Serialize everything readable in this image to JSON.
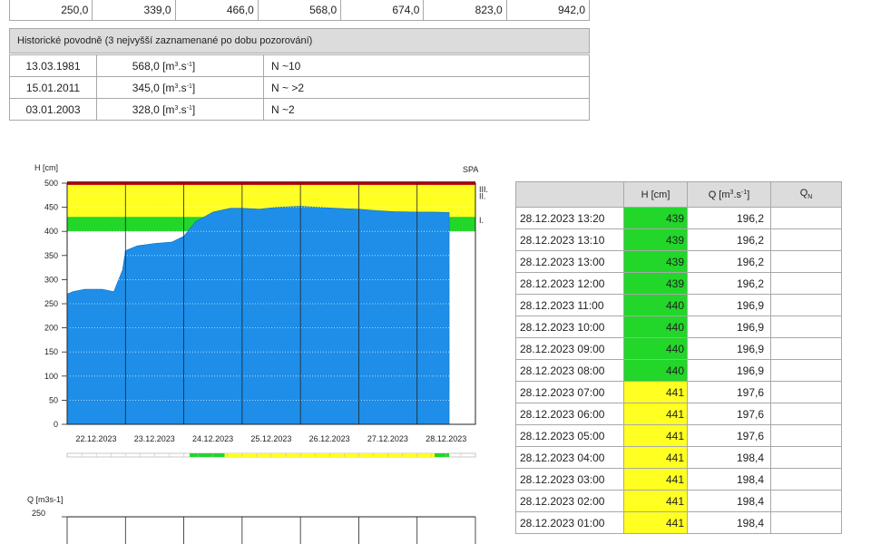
{
  "top_values": [
    "250,0",
    "339,0",
    "466,0",
    "568,0",
    "674,0",
    "823,0",
    "942,0"
  ],
  "historical": {
    "heading": "Historické povodně (3 nejvyšší zaznamenané po dobu pozorování)",
    "rows": [
      {
        "date": "13.03.1981",
        "q": "568,0 [m",
        "q_unit_sup": "3",
        "q_unit_rest": ".s",
        "q_unit_sup2": "-1",
        "q_close": "]",
        "n": "N ~10"
      },
      {
        "date": "15.01.2011",
        "q": "345,0 [m",
        "q_unit_sup": "3",
        "q_unit_rest": ".s",
        "q_unit_sup2": "-1",
        "q_close": "]",
        "n": "N ~ >2"
      },
      {
        "date": "03.01.2003",
        "q": "328,0 [m",
        "q_unit_sup": "3",
        "q_unit_rest": ".s",
        "q_unit_sup2": "-1",
        "q_close": "]",
        "n": "N ~2"
      }
    ]
  },
  "chart_data": {
    "type": "area",
    "ylabel": "H [cm]",
    "spa_label": "SPA",
    "levels": [
      {
        "name": "III.",
        "from": 480,
        "to": 500,
        "color": "#ffff22"
      },
      {
        "name": "II.",
        "from": 430,
        "to": 480,
        "color": "#ffff22"
      },
      {
        "name": "I.",
        "from": 400,
        "to": 430,
        "color": "#22d62a"
      }
    ],
    "extreme_line": {
      "value": 500,
      "color": "#d01010"
    },
    "ylim": [
      0,
      500
    ],
    "yticks": [
      0,
      50,
      100,
      150,
      200,
      250,
      300,
      350,
      400,
      450,
      500
    ],
    "categories": [
      "22.12.2023",
      "23.12.2023",
      "24.12.2023",
      "25.12.2023",
      "26.12.2023",
      "27.12.2023",
      "28.12.2023"
    ],
    "x": [
      0,
      0.1,
      0.3,
      0.6,
      0.8,
      0.95,
      1.0,
      1.2,
      1.5,
      1.8,
      2.0,
      2.2,
      2.5,
      2.8,
      3.0,
      3.3,
      3.6,
      4.0,
      4.3,
      4.6,
      5.0,
      5.3,
      5.6,
      6.0,
      6.3,
      6.55
    ],
    "values": [
      270,
      275,
      280,
      280,
      275,
      320,
      360,
      370,
      375,
      378,
      390,
      420,
      440,
      448,
      448,
      446,
      450,
      452,
      450,
      448,
      446,
      443,
      441,
      440,
      440,
      439
    ],
    "series_color": "#1e8ee8",
    "q_chart": {
      "ylabel": "Q [m3s-1]",
      "ylabel_sup": "3",
      "ylabel_sup2": "-1",
      "ytop": "250"
    }
  },
  "table": {
    "headers": [
      "",
      "H [cm]",
      "Q [m",
      "Q"
    ],
    "q_head_sup": "3",
    "q_head_mid": ".s",
    "q_head_sup2": "-1",
    "q_head_close": "]",
    "qn_sub": "N",
    "rows": [
      {
        "time": "28.12.2023 13:20",
        "h": "439",
        "q": "196,2",
        "status": "green"
      },
      {
        "time": "28.12.2023 13:10",
        "h": "439",
        "q": "196,2",
        "status": "green"
      },
      {
        "time": "28.12.2023 13:00",
        "h": "439",
        "q": "196,2",
        "status": "green"
      },
      {
        "time": "28.12.2023 12:00",
        "h": "439",
        "q": "196,2",
        "status": "green"
      },
      {
        "time": "28.12.2023 11:00",
        "h": "440",
        "q": "196,9",
        "status": "green"
      },
      {
        "time": "28.12.2023 10:00",
        "h": "440",
        "q": "196,9",
        "status": "green"
      },
      {
        "time": "28.12.2023 09:00",
        "h": "440",
        "q": "196,9",
        "status": "green"
      },
      {
        "time": "28.12.2023 08:00",
        "h": "440",
        "q": "196,9",
        "status": "green"
      },
      {
        "time": "28.12.2023 07:00",
        "h": "441",
        "q": "197,6",
        "status": "yellow"
      },
      {
        "time": "28.12.2023 06:00",
        "h": "441",
        "q": "197,6",
        "status": "yellow"
      },
      {
        "time": "28.12.2023 05:00",
        "h": "441",
        "q": "197,6",
        "status": "yellow"
      },
      {
        "time": "28.12.2023 04:00",
        "h": "441",
        "q": "198,4",
        "status": "yellow"
      },
      {
        "time": "28.12.2023 03:00",
        "h": "441",
        "q": "198,4",
        "status": "yellow"
      },
      {
        "time": "28.12.2023 02:00",
        "h": "441",
        "q": "198,4",
        "status": "yellow"
      },
      {
        "time": "28.12.2023 01:00",
        "h": "441",
        "q": "198,4",
        "status": "yellow"
      }
    ]
  }
}
